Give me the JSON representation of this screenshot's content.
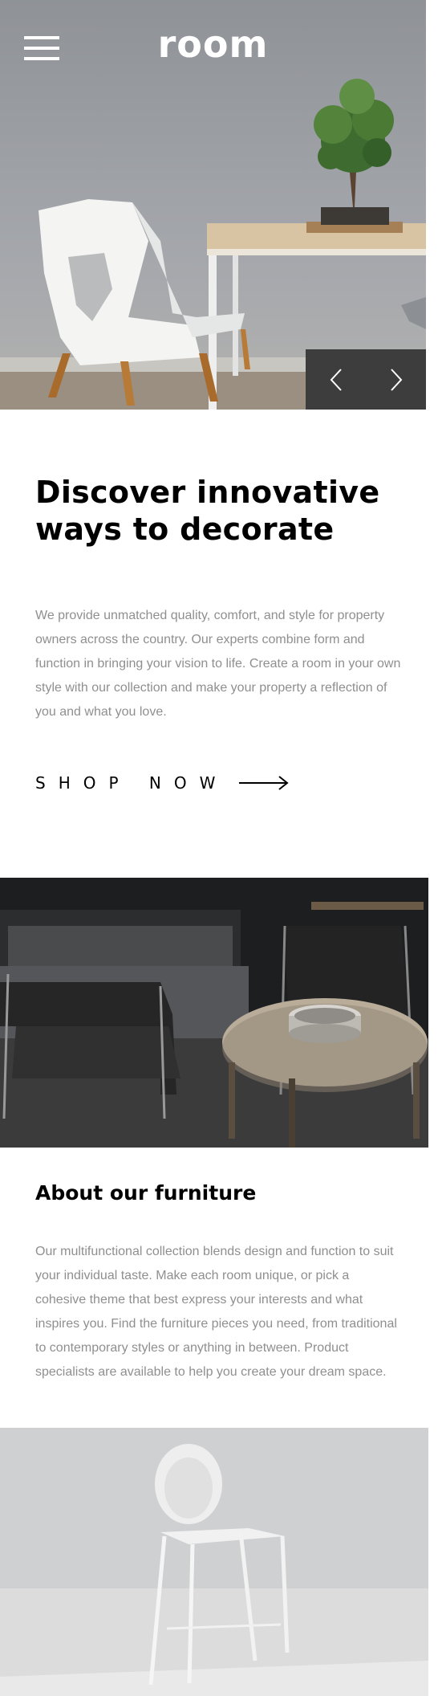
{
  "header": {
    "logo": "room",
    "menu_icon": "hamburger-menu-icon"
  },
  "hero": {
    "prev_icon": "chevron-left-icon",
    "next_icon": "chevron-right-icon"
  },
  "intro": {
    "title_line1": "Discover innovative",
    "title_line2": "ways to decorate",
    "body": "We provide unmatched quality, comfort, and style for property owners across the country. Our experts combine form and function in bringing your vision to life. Create a room in your own style with our collection and make your property a reflection of you and what you love.",
    "cta_label": "SHOP NOW",
    "cta_icon": "arrow-right-icon"
  },
  "about": {
    "title": "About our furniture",
    "body": "Our multifunctional collection blends design and function to suit your individual taste. Make each room unique, or pick a cohesive theme that best express your interests and what inspires you. Find the furniture pieces you need, from traditional to contemporary styles or anything in between. Product specialists are available to help you create your dream space."
  },
  "colors": {
    "text": "#000000",
    "body_text": "#8f8f8f",
    "slider_bg": "#3d3d3d"
  }
}
